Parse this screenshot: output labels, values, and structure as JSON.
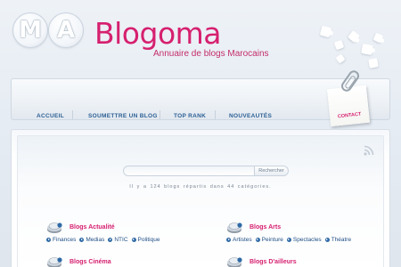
{
  "logo": {
    "initial_1": "M",
    "initial_2": "A",
    "brand": "Blogoma",
    "tagline": "Annuaire de blogs Marocains"
  },
  "nav": {
    "items": [
      "ACCUEIL",
      "SOUMETTRE UN BLOG",
      "TOP RANK",
      "NOUVEAUTÉS"
    ],
    "contact": "CONTACT"
  },
  "search": {
    "placeholder": "",
    "button": "Rechercher"
  },
  "stats": "Il y a 124 blogs répartis dans 44 catégories.",
  "categories": [
    {
      "title": "Blogs Actualité",
      "links": [
        "Finances",
        "Medias",
        "NTIC",
        "Politique"
      ]
    },
    {
      "title": "Blogs Arts",
      "links": [
        "Artistes",
        "Peinture",
        "Spectacles",
        "Théatre"
      ]
    },
    {
      "title": "Blogs Cinéma",
      "links": []
    },
    {
      "title": "Blogs D'ailleurs",
      "links": []
    }
  ],
  "colors": {
    "brand_pink": "#d6206f",
    "link_blue": "#1f4f84",
    "nav_blue": "#2b5f94"
  },
  "icons": {
    "rss": "rss-icon",
    "category": "category-stack-icon",
    "link_arrow": "arrow-bullet-icon"
  }
}
